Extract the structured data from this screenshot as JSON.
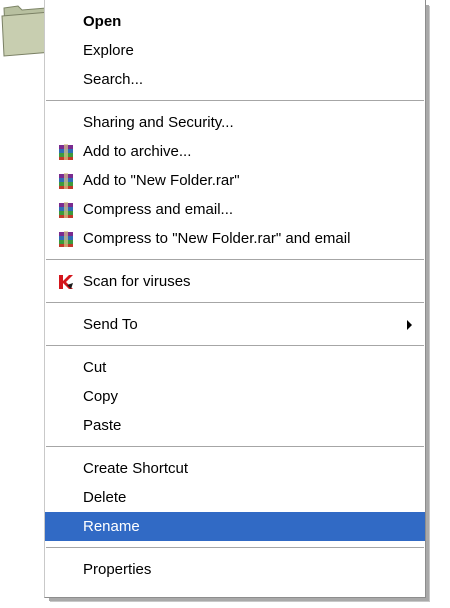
{
  "menu": {
    "groups": [
      [
        {
          "label": "Open",
          "bold": true
        },
        {
          "label": "Explore"
        },
        {
          "label": "Search..."
        }
      ],
      [
        {
          "label": "Sharing and Security..."
        },
        {
          "label": "Add to archive...",
          "icon": "winrar-icon"
        },
        {
          "label": "Add to \"New Folder.rar\"",
          "icon": "winrar-icon"
        },
        {
          "label": "Compress and email...",
          "icon": "winrar-icon"
        },
        {
          "label": "Compress to \"New Folder.rar\" and email",
          "icon": "winrar-icon"
        }
      ],
      [
        {
          "label": "Scan for viruses",
          "icon": "kaspersky-icon"
        }
      ],
      [
        {
          "label": "Send To",
          "submenu": true
        }
      ],
      [
        {
          "label": "Cut"
        },
        {
          "label": "Copy"
        },
        {
          "label": "Paste"
        }
      ],
      [
        {
          "label": "Create Shortcut"
        },
        {
          "label": "Delete"
        },
        {
          "label": "Rename",
          "selected": true
        }
      ],
      [
        {
          "label": "Properties"
        }
      ]
    ]
  },
  "colors": {
    "selection": "#316ac5",
    "selection_text": "#ffffff",
    "separator": "#a6a6a6"
  }
}
